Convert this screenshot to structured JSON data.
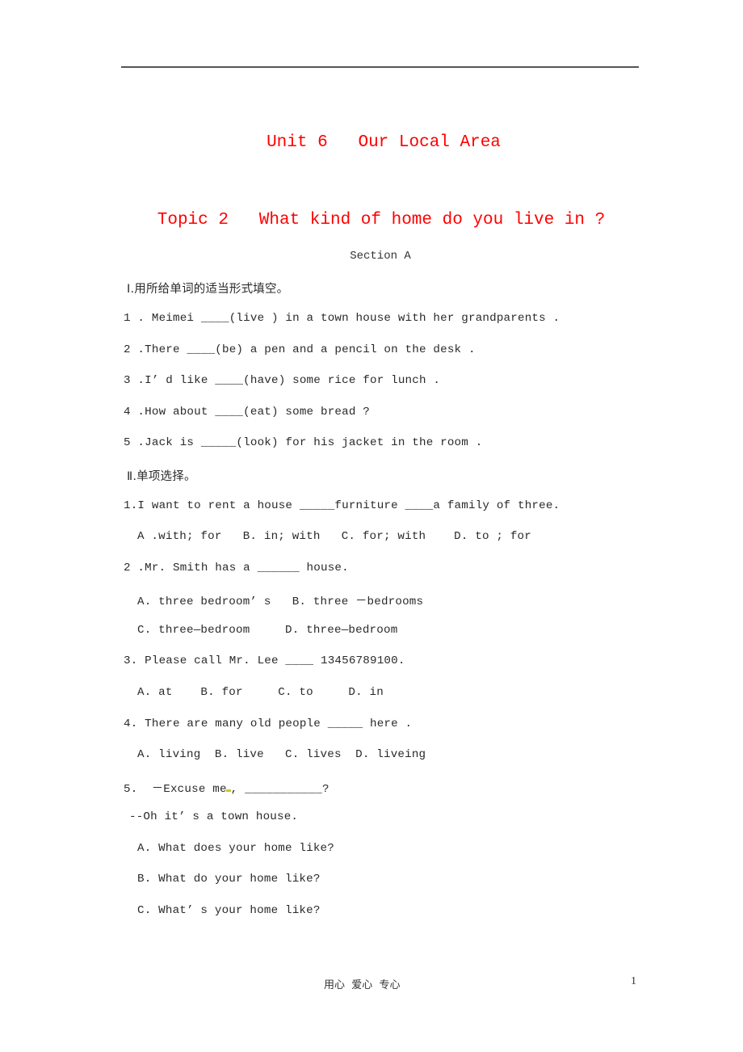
{
  "document": {
    "unit_title": "Unit 6   Our Local Area",
    "topic_title": "Topic 2   What kind of home do you live in ?",
    "section_label": "Section A",
    "part1": {
      "heading": "Ⅰ.用所给单词的适当形式填空。",
      "items": [
        "1 . Meimei ____(live ) in a town house with her grandparents .",
        "2 .There ____(be) a pen and a pencil on the desk .",
        "3 .I’ d like ____(have) some rice for lunch .",
        "4 .How about ____(eat) some bread ?",
        "5 .Jack is _____(look) for his jacket in the room ."
      ]
    },
    "part2": {
      "heading": "Ⅱ.单项选择。",
      "q1": {
        "question": "1.I want to rent a house _____furniture ____a family of three.",
        "options": "A .with; for   B. in; with   C. for; with    D. to ; for"
      },
      "q2": {
        "question": "2 .Mr. Smith has a ______ house.",
        "options_line1": "A. three bedroom’ s   B. three －bedrooms",
        "options_line2": "C. three—bedroom     D. three—bedroom"
      },
      "q3": {
        "question": "3. Please call Mr. Lee ____ 13456789100.",
        "options": "A. at    B. for     C. to     D. in"
      },
      "q4": {
        "question": "4. There are many old people _____ here .",
        "options": "A. living  B. live   C. lives  D. liveing"
      },
      "q5": {
        "question_prefix": "5.  －Excuse me",
        "question_suffix": ", ___________?",
        "answer": "--Oh it’ s a town house.",
        "option_a": "A. What does your home like?",
        "option_b": "B. What do your home like?",
        "option_c": "C. What’ s your home like?"
      }
    }
  },
  "footer": {
    "motto": "用心  爱心  专心",
    "page_number": "1"
  }
}
